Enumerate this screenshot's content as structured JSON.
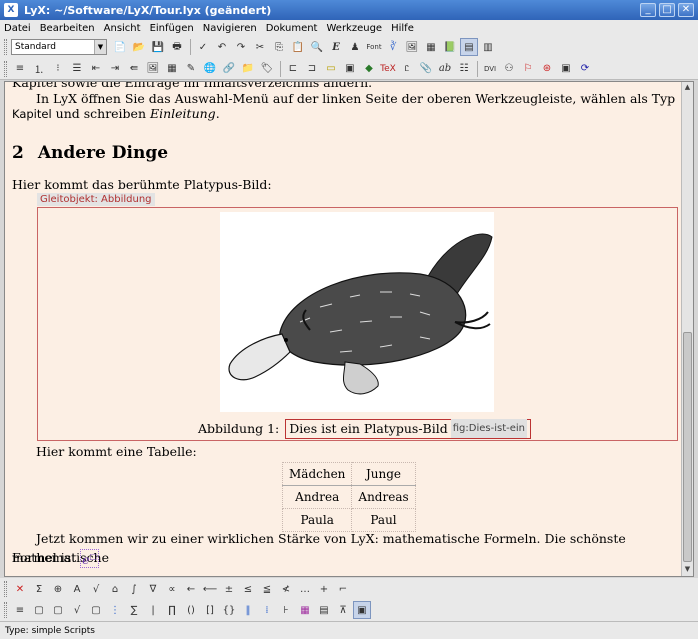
{
  "window": {
    "title": "LyX: ~/Software/LyX/Tour.lyx (geändert)",
    "app_icon": "X"
  },
  "menu": [
    "Datei",
    "Bearbeiten",
    "Ansicht",
    "Einfügen",
    "Navigieren",
    "Dokument",
    "Werkzeuge",
    "Hilfe"
  ],
  "toolbar": {
    "paragraph_style": "Standard",
    "row1_icons": [
      "new-icon",
      "open-icon",
      "save-icon",
      "print-icon",
      "spellcheck-icon",
      "undo-icon",
      "redo-icon",
      "cut-icon",
      "copy-icon",
      "paste-icon",
      "find-icon",
      "emphasis-icon",
      "noun-icon",
      "font-icon",
      "math-icon",
      "insert-graphics-icon",
      "insert-table-icon",
      "toc-icon",
      "view-source-icon",
      "toggle-toolbar-icon"
    ],
    "row2_icons": [
      "itemize-icon",
      "enumerate-icon",
      "description-icon",
      "depth-decrease-icon",
      "depth-increase-icon",
      "insert-float-icon",
      "insert-image-icon",
      "table-icon",
      "note-icon",
      "hyperlink-icon",
      "citation-icon",
      "index-icon",
      "label-icon",
      "cross-ref-icon",
      "footnote-icon",
      "margin-note-icon",
      "ert-icon",
      "tex-icon",
      "math-mode-icon",
      "text-style-icon",
      "ab-icon",
      "paragraph-settings-icon",
      "dvi-icon",
      "view-ps-icon",
      "pdf-icon",
      "update-icon",
      "view-html-icon",
      "refresh-icon"
    ],
    "glyphs": {
      "font": "Font",
      "tex": "TeX",
      "ab": "ab",
      "emph": "E"
    }
  },
  "document": {
    "partial_line": "Kapitel sowie die Einträge im Inhaltsverzeichnis ändern.",
    "para1_a": "In LyX öffnen Sie das Auswahl-Menü auf der linken Seite der oberen Werkzeugleiste, wählen als Typ",
    "para1_b_sans": "Kapitel",
    "para1_b_mid": " und schreiben ",
    "para1_b_italic": "Einleitung",
    "para1_b_end": ".",
    "section_num": "2",
    "section_title": "Andere Dinge",
    "para2": "Hier kommt das berühmte Platypus-Bild:",
    "float_label": "Gleitobjekt: Abbildung",
    "caption_label": "Abbildung 1:",
    "caption_text": "Dies ist ein Platypus-Bild",
    "caption_ref": "fig:Dies-ist-ein",
    "para3": "Hier kommt eine Tabelle:",
    "table": [
      [
        "Mädchen",
        "Junge"
      ],
      [
        "Andrea",
        "Andreas"
      ],
      [
        "Paula",
        "Paul"
      ]
    ],
    "para4_a": "Jetzt kommen wir zu einer wirklichen Stärke von LyX: mathematische Formeln. Die schönste mathematische",
    "para4_b": "Formel ist ",
    "formula_base": "e",
    "formula_sup": "□"
  },
  "math_toolbar": {
    "row1": [
      "✕",
      "Σ",
      "⊕",
      "Α",
      "√",
      "⌂",
      "∫",
      "∇",
      "∝",
      "←",
      "⟵",
      "±",
      "≤",
      "≦",
      "≮",
      "…",
      "+",
      "⌐"
    ],
    "row2": [
      "≡",
      "▢",
      "▢",
      "√",
      "▢",
      "⋮",
      "∑",
      "|",
      "∏",
      "()",
      "[]",
      "{}",
      "‖",
      "⁞",
      "⊦",
      "▦",
      "▤",
      "⊼",
      "▣"
    ]
  },
  "status": "Type: simple  Scripts"
}
